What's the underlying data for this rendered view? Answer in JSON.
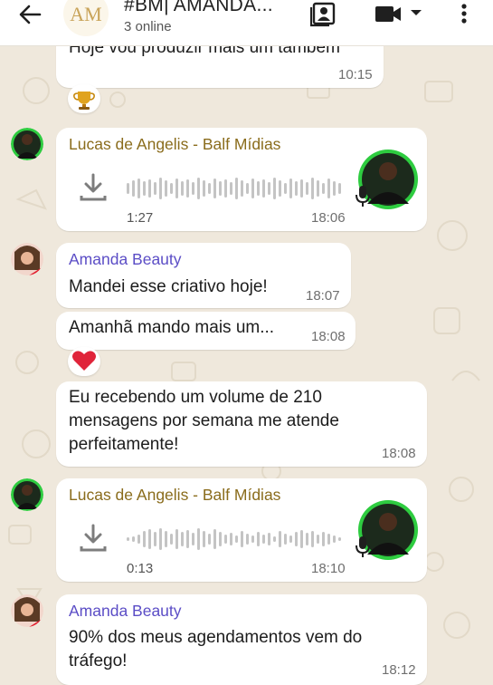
{
  "header": {
    "title": "#BM| AMANDA...",
    "status": "3 online",
    "logo_text": "AM"
  },
  "messages": [
    {
      "text": "Hoje vou produzir mais um também",
      "time": "10:15",
      "reaction": "trophy"
    },
    {
      "sender": "Lucas de Angelis - Balf Mídias",
      "type": "audio",
      "duration": "1:27",
      "time": "18:06"
    },
    {
      "sender": "Amanda Beauty",
      "text": "Mandei esse criativo hoje!",
      "time": "18:07"
    },
    {
      "text": "Amanhã mando mais um...",
      "time": "18:08",
      "reaction": "heart"
    },
    {
      "text_lines": [
        "Eu recebendo um volume de 210",
        "mensagens por semana me atende",
        "perfeitamente!"
      ],
      "time": "18:08"
    },
    {
      "sender": "Lucas de Angelis - Balf Mídias",
      "type": "audio",
      "duration": "0:13",
      "time": "18:10"
    },
    {
      "sender": "Amanda Beauty",
      "text_lines": [
        "90% dos meus agendamentos vem do",
        "tráfego!"
      ],
      "time": "18:12"
    }
  ],
  "icons": [
    "back-arrow-icon",
    "contact-card-icon",
    "video-call-icon",
    "dropdown-icon",
    "more-options-icon",
    "download-icon",
    "microphone-icon"
  ],
  "colors": {
    "chat_background": "#efe8dc",
    "bubble": "#ffffff",
    "lucas_name": "#8a6c1c",
    "amanda_name": "#5b4dc6",
    "waveform": "#c4c4c4",
    "avatar_green": "#2ecc40"
  }
}
